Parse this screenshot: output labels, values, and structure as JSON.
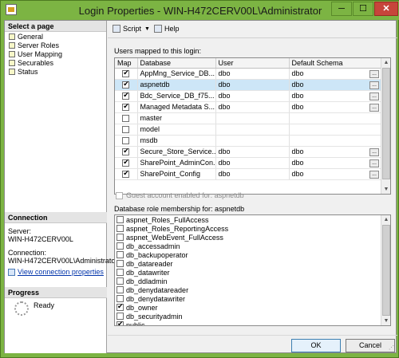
{
  "window": {
    "title": "Login Properties - WIN-H472CERV00L\\Administrator",
    "controls": {
      "minimize": "─",
      "maximize": "☐",
      "close": "✕"
    }
  },
  "left_pane": {
    "select_page_header": "Select a page",
    "pages": [
      {
        "label": "General",
        "icon": "page-icon"
      },
      {
        "label": "Server Roles",
        "icon": "page-icon"
      },
      {
        "label": "User Mapping",
        "icon": "page-icon"
      },
      {
        "label": "Securables",
        "icon": "page-icon"
      },
      {
        "label": "Status",
        "icon": "page-icon"
      }
    ],
    "connection": {
      "header": "Connection",
      "server_label": "Server:",
      "server_value": "WIN-H472CERV00L",
      "connection_label": "Connection:",
      "connection_value": "WIN-H472CERV00L\\Administrator",
      "view_link": "View connection properties"
    },
    "progress": {
      "header": "Progress",
      "status": "Ready"
    }
  },
  "toolbar": {
    "script_label": "Script",
    "help_label": "Help"
  },
  "users_mapped": {
    "label": "Users mapped to this login:",
    "columns": [
      "Map",
      "Database",
      "User",
      "Default Schema"
    ],
    "rows": [
      {
        "checked": true,
        "database": "AppMng_Service_DB...",
        "user": "dbo",
        "schema": "dbo",
        "ellipsis": true,
        "selected": false
      },
      {
        "checked": true,
        "database": "aspnetdb",
        "user": "dbo",
        "schema": "dbo",
        "ellipsis": true,
        "selected": true
      },
      {
        "checked": true,
        "database": "Bdc_Service_DB_f75...",
        "user": "dbo",
        "schema": "dbo",
        "ellipsis": true,
        "selected": false
      },
      {
        "checked": true,
        "database": "Managed Metadata S...",
        "user": "dbo",
        "schema": "dbo",
        "ellipsis": true,
        "selected": false
      },
      {
        "checked": false,
        "database": "master",
        "user": "",
        "schema": "",
        "ellipsis": false,
        "selected": false
      },
      {
        "checked": false,
        "database": "model",
        "user": "",
        "schema": "",
        "ellipsis": false,
        "selected": false
      },
      {
        "checked": false,
        "database": "msdb",
        "user": "",
        "schema": "",
        "ellipsis": false,
        "selected": false
      },
      {
        "checked": true,
        "database": "Secure_Store_Service...",
        "user": "dbo",
        "schema": "dbo",
        "ellipsis": true,
        "selected": false
      },
      {
        "checked": true,
        "database": "SharePoint_AdminCon...",
        "user": "dbo",
        "schema": "dbo",
        "ellipsis": true,
        "selected": false
      },
      {
        "checked": true,
        "database": "SharePoint_Config",
        "user": "dbo",
        "schema": "dbo",
        "ellipsis": true,
        "selected": false
      }
    ]
  },
  "guest": {
    "label": "Guest account enabled for: aspnetdb",
    "checked": false
  },
  "role_membership": {
    "label": "Database role membership for: aspnetdb",
    "roles": [
      {
        "name": "aspnet_Roles_FullAccess",
        "checked": false
      },
      {
        "name": "aspnet_Roles_ReportingAccess",
        "checked": false
      },
      {
        "name": "aspnet_WebEvent_FullAccess",
        "checked": false
      },
      {
        "name": "db_accessadmin",
        "checked": false
      },
      {
        "name": "db_backupoperator",
        "checked": false
      },
      {
        "name": "db_datareader",
        "checked": false
      },
      {
        "name": "db_datawriter",
        "checked": false
      },
      {
        "name": "db_ddladmin",
        "checked": false
      },
      {
        "name": "db_denydatareader",
        "checked": false
      },
      {
        "name": "db_denydatawriter",
        "checked": false
      },
      {
        "name": "db_owner",
        "checked": true
      },
      {
        "name": "db_securityadmin",
        "checked": false
      },
      {
        "name": "public",
        "checked": true
      }
    ]
  },
  "buttons": {
    "ok": "OK",
    "cancel": "Cancel"
  }
}
